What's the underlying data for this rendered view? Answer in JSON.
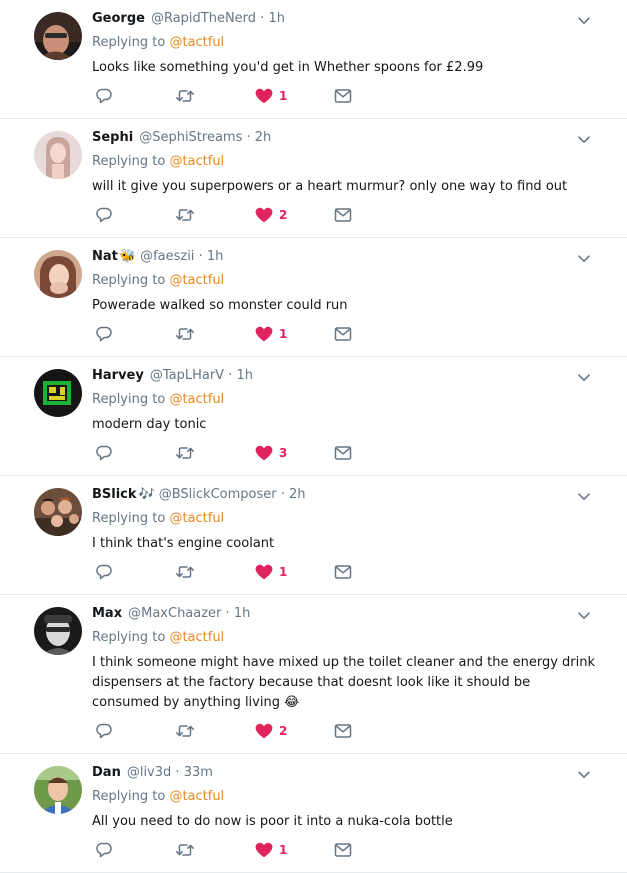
{
  "colors": {
    "mention": "#e8891d",
    "like": "#e0245e",
    "muted": "#657786",
    "divider": "#e6ecf0"
  },
  "icons": {
    "reply": "reply-icon",
    "retweet": "retweet-icon",
    "like": "heart-icon",
    "dm": "envelope-icon",
    "menu": "chevron-down-icon"
  },
  "replies": [
    {
      "name": "George",
      "emoji": "",
      "handle": "@RapidTheNerd",
      "time": "1h",
      "replying_label": "Replying to",
      "mention": "@tactful",
      "text": "Looks like something you'd get in Whether spoons for £2.99",
      "likes": "1"
    },
    {
      "name": "Sephi",
      "emoji": "",
      "handle": "@SephiStreams",
      "time": "2h",
      "replying_label": "Replying to",
      "mention": "@tactful",
      "text": "will it give you superpowers or a heart murmur? only one way to find out",
      "likes": "2"
    },
    {
      "name": "Nat",
      "emoji": "🐝",
      "handle": "@faeszii",
      "time": "1h",
      "replying_label": "Replying to",
      "mention": "@tactful",
      "text": "Powerade walked so monster could run",
      "likes": "1"
    },
    {
      "name": "Harvey",
      "emoji": "",
      "handle": "@TapLHarV",
      "time": "1h",
      "replying_label": "Replying to",
      "mention": "@tactful",
      "text": "modern day tonic",
      "likes": "3"
    },
    {
      "name": "BSlick",
      "emoji": "🎶",
      "handle": "@BSlickComposer",
      "time": "2h",
      "replying_label": "Replying to",
      "mention": "@tactful",
      "text": "I think that's engine coolant",
      "likes": "1"
    },
    {
      "name": "Max",
      "emoji": "",
      "handle": "@MaxChaazer",
      "time": "1h",
      "replying_label": "Replying to",
      "mention": "@tactful",
      "text": "I think someone might have mixed up the toilet cleaner and the energy drink dispensers at the factory because that doesnt look like it should be consumed by anything living 😂",
      "likes": "2"
    },
    {
      "name": "Dan",
      "emoji": "",
      "handle": "@liv3d",
      "time": "33m",
      "replying_label": "Replying to",
      "mention": "@tactful",
      "text": "All you need to do now is poor it into a nuka-cola bottle",
      "likes": "1"
    }
  ]
}
